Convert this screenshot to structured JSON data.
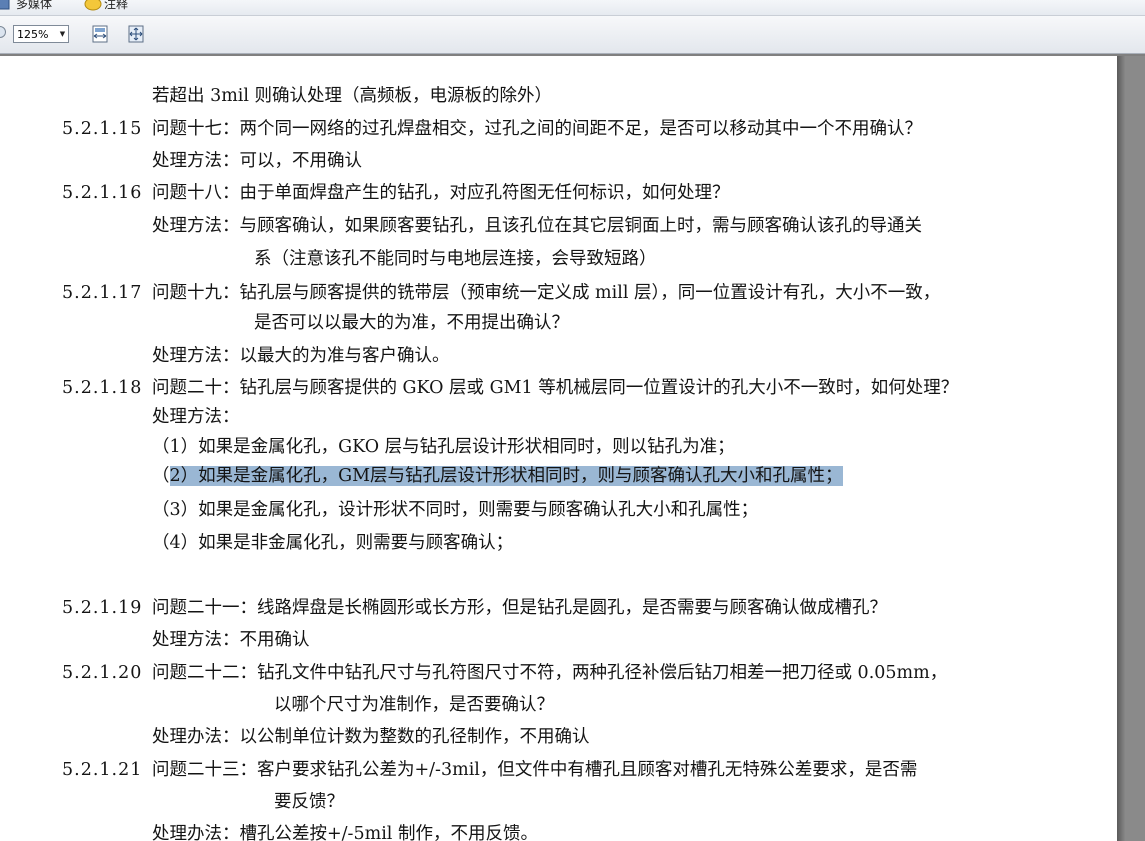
{
  "menu": {
    "item1": "多媒体",
    "item2": "注释"
  },
  "toolbar": {
    "zoom": "125%"
  },
  "doc": {
    "l01": "若超出 3mil 则确认处理（高频板，电源板的除外）",
    "n15": "5.2.1.15",
    "l02": "问题十七：两个同一网络的过孔焊盘相交，过孔之间的间距不足，是否可以移动其中一个不用确认？",
    "l03": "处理方法：可以，不用确认",
    "n16": "5.2.1.16",
    "l04": "问题十八：由于单面焊盘产生的钻孔，对应孔符图无任何标识，如何处理？",
    "l05": "处理方法：与顾客确认，如果顾客要钻孔，且该孔位在其它层铜面上时，需与顾客确认该孔的导通关",
    "l06": "系（注意该孔不能同时与电地层连接，会导致短路）",
    "n17": "5.2.1.17",
    "l07": "问题十九：钻孔层与顾客提供的铣带层（预审统一定义成 mill 层），同一位置设计有孔，大小不一致，",
    "l08": "是否可以以最大的为准，不用提出确认？",
    "l09": "处理方法：以最大的为准与客户确认。",
    "n18": "5.2.1.18",
    "l10": "问题二十：钻孔层与顾客提供的 GKO 层或 GM1 等机械层同一位置设计的孔大小不一致时，如何处理？",
    "l11": "处理方法：",
    "l12": "（1）如果是金属化孔，GKO 层与钻孔层设计形状相同时，则以钻孔为准；",
    "l13a": "（",
    "l13b": "2）如果是金属化孔，GM层与钻孔层设计形状相同时，则与顾客确认孔大小和孔属性；",
    "l14": "（3）如果是金属化孔，设计形状不同时，则需要与顾客确认孔大小和孔属性；",
    "l15": "（4）如果是非金属化孔，则需要与顾客确认；",
    "n19": "5.2.1.19",
    "l16": "问题二十一：线路焊盘是长椭圆形或长方形，但是钻孔是圆孔，是否需要与顾客确认做成槽孔？",
    "l17": "处理方法：不用确认",
    "n20": "5.2.1.20",
    "l18": "问题二十二：钻孔文件中钻孔尺寸与孔符图尺寸不符，两种孔径补偿后钻刀相差一把刀径或 0.05mm，",
    "l19": "以哪个尺寸为准制作，是否要确认？",
    "l20": "处理办法：以公制单位计数为整数的孔径制作，不用确认",
    "n21": "5.2.1.21",
    "l21": "问题二十三：客户要求钻孔公差为+/-3mil，但文件中有槽孔且顾客对槽孔无特殊公差要求，是否需",
    "l22": "要反馈？",
    "l23": "处理办法：槽孔公差按+/-5mil 制作，不用反馈。"
  }
}
